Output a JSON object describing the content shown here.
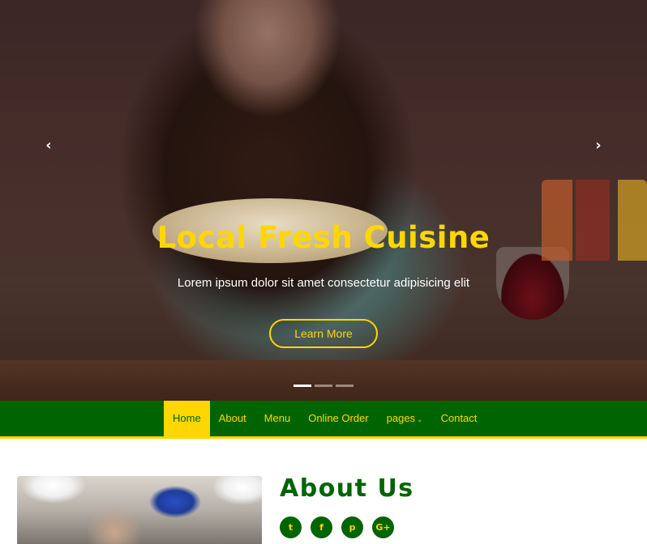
{
  "hero": {
    "title": "Local Fresh Cuisine",
    "subtitle": "Lorem ipsum dolor sit amet consectetur adipisicing elit",
    "button_label": "Learn More",
    "prev_arrow": "‹",
    "next_arrow": "›",
    "slides": 3,
    "active_slide": 1
  },
  "nav": {
    "items": [
      {
        "label": "Home",
        "active": true
      },
      {
        "label": "About"
      },
      {
        "label": "Menu"
      },
      {
        "label": "Online Order"
      },
      {
        "label": "pages",
        "dropdown": true
      },
      {
        "label": "Contact"
      }
    ],
    "dropdown_caret": "⌄"
  },
  "about": {
    "title": "About Us",
    "social": [
      {
        "icon": "twitter-icon",
        "glyph": "t"
      },
      {
        "icon": "facebook-icon",
        "glyph": "f"
      },
      {
        "icon": "pinterest-icon",
        "glyph": "p"
      },
      {
        "icon": "google-plus-icon",
        "glyph": "G+"
      }
    ]
  },
  "colors": {
    "primary_green": "#006400",
    "accent_yellow": "#ffd700"
  }
}
